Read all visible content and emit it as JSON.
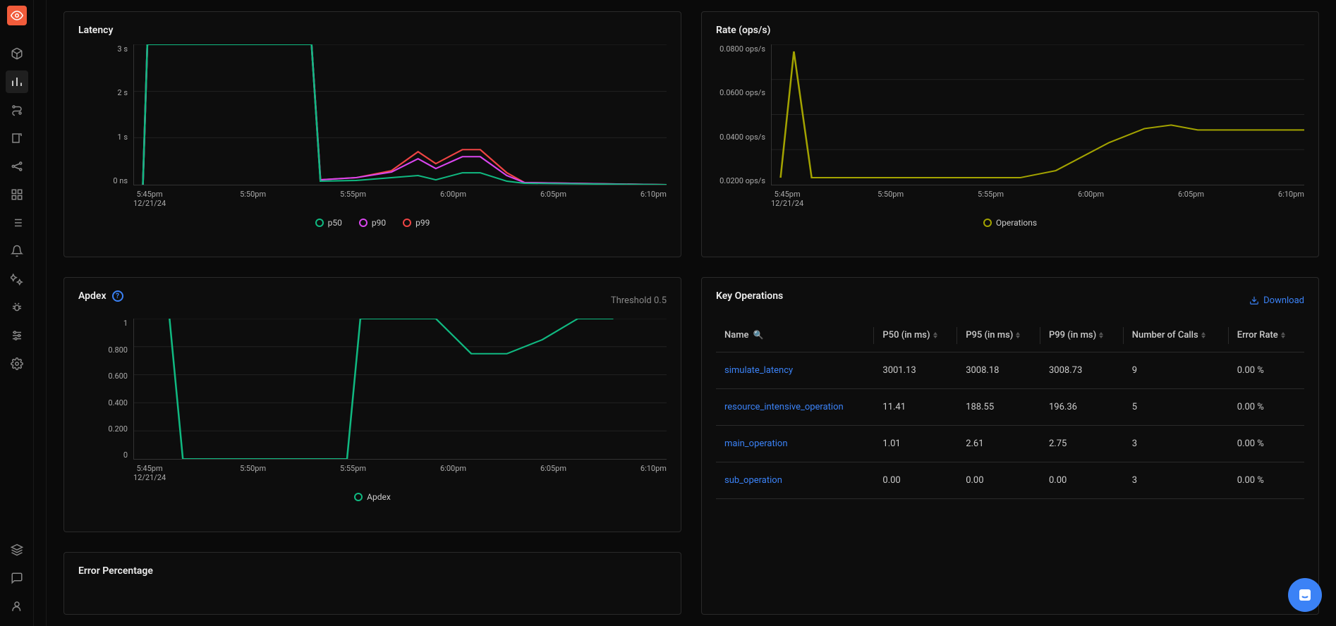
{
  "sidebar": {
    "logo_icon": "eye",
    "nav": [
      {
        "name": "cube",
        "active": false
      },
      {
        "name": "analytics",
        "active": true
      },
      {
        "name": "journey",
        "active": false
      },
      {
        "name": "scroll",
        "active": false
      },
      {
        "name": "graph",
        "active": false
      },
      {
        "name": "dashboard",
        "active": false
      },
      {
        "name": "list",
        "active": false
      },
      {
        "name": "alerts",
        "active": false
      },
      {
        "name": "magic",
        "active": false
      },
      {
        "name": "bug",
        "active": false
      },
      {
        "name": "settings-lines",
        "active": false
      },
      {
        "name": "gear",
        "active": false
      }
    ],
    "footer": [
      {
        "name": "layers"
      },
      {
        "name": "chat"
      },
      {
        "name": "user"
      }
    ]
  },
  "latency_panel": {
    "title": "Latency",
    "legend": [
      {
        "label": "p50",
        "color": "#10b981"
      },
      {
        "label": "p90",
        "color": "#d946ef"
      },
      {
        "label": "p99",
        "color": "#ef4444"
      }
    ]
  },
  "rate_panel": {
    "title": "Rate (ops/s)",
    "legend": [
      {
        "label": "Operations",
        "color": "#a3a300"
      }
    ]
  },
  "apdex_panel": {
    "title": "Apdex",
    "threshold_label": "Threshold 0.5",
    "legend": [
      {
        "label": "Apdex",
        "color": "#10b981"
      }
    ]
  },
  "error_panel": {
    "title": "Error Percentage"
  },
  "table_panel": {
    "title": "Key Operations",
    "download_label": "Download",
    "columns": [
      "Name",
      "P50 (in ms)",
      "P95 (in ms)",
      "P99 (in ms)",
      "Number of Calls",
      "Error Rate"
    ],
    "rows": [
      {
        "name": "simulate_latency",
        "p50": "3001.13",
        "p95": "3008.18",
        "p99": "3008.73",
        "calls": "9",
        "err": "0.00 %"
      },
      {
        "name": "resource_intensive_operation",
        "p50": "11.41",
        "p95": "188.55",
        "p99": "196.36",
        "calls": "5",
        "err": "0.00 %"
      },
      {
        "name": "main_operation",
        "p50": "1.01",
        "p95": "2.61",
        "p99": "2.75",
        "calls": "3",
        "err": "0.00 %"
      },
      {
        "name": "sub_operation",
        "p50": "0.00",
        "p95": "0.00",
        "p99": "0.00",
        "calls": "3",
        "err": "0.00 %"
      }
    ]
  },
  "chart_data": [
    {
      "type": "line",
      "title": "Latency",
      "xlabel": "",
      "ylabel": "",
      "y_ticks": [
        "3 s",
        "2 s",
        "1 s",
        "0 ns"
      ],
      "x_ticks": [
        "5:45pm",
        "5:50pm",
        "5:55pm",
        "6:00pm",
        "6:05pm",
        "6:10pm"
      ],
      "x_date": "12/21/24",
      "ylim": [
        0,
        3
      ],
      "series": [
        {
          "name": "p50",
          "color": "#10b981",
          "values": [
            0,
            3.0,
            3.0,
            3.0,
            0.1,
            0.1,
            0.15,
            0.2,
            0.1,
            0.15,
            0.25,
            0.1,
            0.05,
            0
          ]
        },
        {
          "name": "p90",
          "color": "#d946ef",
          "values": [
            0,
            3.0,
            3.0,
            3.0,
            0.15,
            0.2,
            0.35,
            0.55,
            0.35,
            0.55,
            0.6,
            0.2,
            0.05,
            0
          ]
        },
        {
          "name": "p99",
          "color": "#ef4444",
          "values": [
            0,
            3.0,
            3.0,
            3.0,
            0.2,
            0.25,
            0.45,
            0.7,
            0.45,
            0.7,
            0.75,
            0.25,
            0.05,
            0
          ]
        }
      ]
    },
    {
      "type": "line",
      "title": "Rate (ops/s)",
      "y_ticks": [
        "0.0800 ops/s",
        "0.0600 ops/s",
        "0.0400 ops/s",
        "0.0200 ops/s"
      ],
      "x_ticks": [
        "5:45pm",
        "5:50pm",
        "5:55pm",
        "6:00pm",
        "6:05pm",
        "6:10pm"
      ],
      "x_date": "12/21/24",
      "ylim": [
        0,
        0.09
      ],
      "series": [
        {
          "name": "Operations",
          "color": "#a3a300",
          "values": [
            0.01,
            0.085,
            0.01,
            0.01,
            0.01,
            0.01,
            0.01,
            0.015,
            0.025,
            0.035,
            0.04,
            0.04,
            0.035,
            0.035
          ]
        }
      ]
    },
    {
      "type": "line",
      "title": "Apdex",
      "y_ticks": [
        "1",
        "0.800",
        "0.600",
        "0.400",
        "0.200",
        "0"
      ],
      "x_ticks": [
        "5:45pm",
        "5:50pm",
        "5:55pm",
        "6:00pm",
        "6:05pm",
        "6:10pm"
      ],
      "x_date": "12/21/24",
      "ylim": [
        0,
        1
      ],
      "series": [
        {
          "name": "Apdex",
          "color": "#10b981",
          "values": [
            1.0,
            0.0,
            0.0,
            0.0,
            0.0,
            1.0,
            1.0,
            0.75,
            0.75,
            0.85,
            1.0,
            1.0
          ]
        }
      ]
    }
  ]
}
